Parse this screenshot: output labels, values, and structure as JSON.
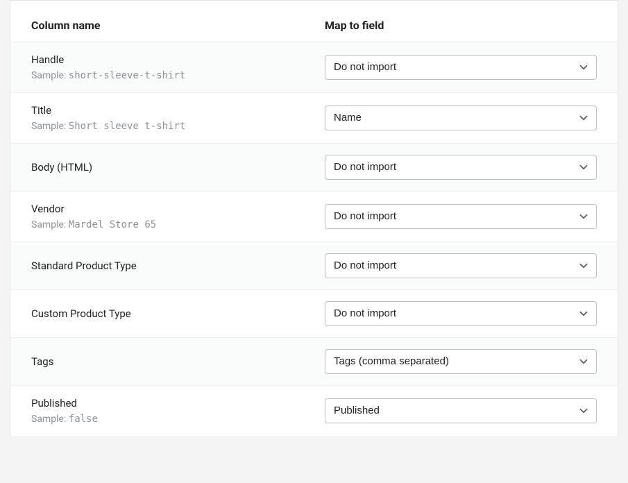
{
  "header": {
    "column_name_label": "Column name",
    "map_to_field_label": "Map to field"
  },
  "sample_prefix": "Sample: ",
  "rows": [
    {
      "name": "Handle",
      "sample": "short-sleeve-t-shirt",
      "selected": "Do not import"
    },
    {
      "name": "Title",
      "sample": "Short sleeve t-shirt",
      "selected": "Name"
    },
    {
      "name": "Body (HTML)",
      "sample": null,
      "selected": "Do not import"
    },
    {
      "name": "Vendor",
      "sample": "Mardel Store 65",
      "selected": "Do not import"
    },
    {
      "name": "Standard Product Type",
      "sample": null,
      "selected": "Do not import"
    },
    {
      "name": "Custom Product Type",
      "sample": null,
      "selected": "Do not import"
    },
    {
      "name": "Tags",
      "sample": null,
      "selected": "Tags (comma separated)"
    },
    {
      "name": "Published",
      "sample": "false",
      "selected": "Published"
    }
  ]
}
